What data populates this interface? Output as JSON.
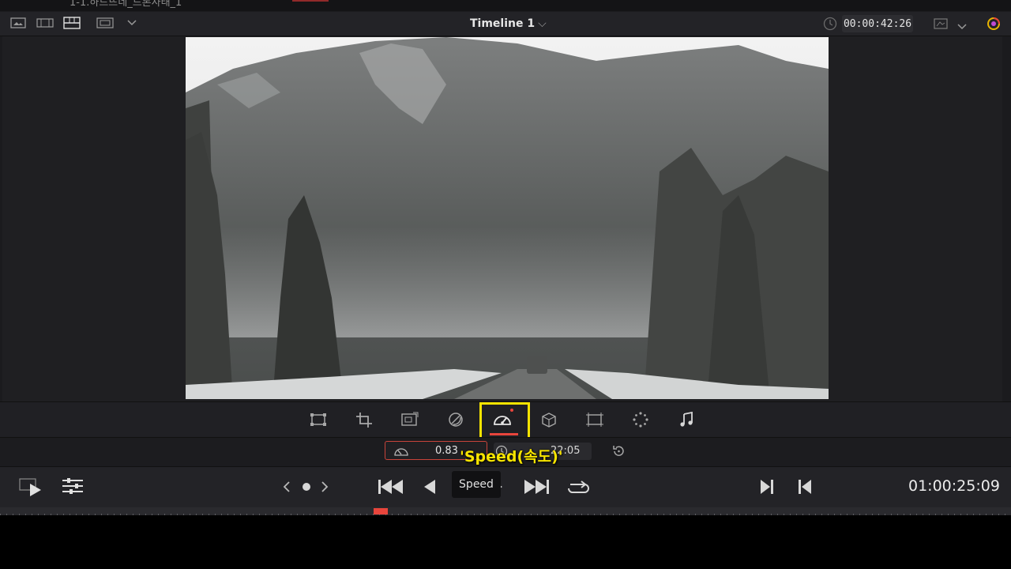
{
  "window": {
    "title": "1-1.하드뜨네_드론사태_1"
  },
  "viewer": {
    "timeline_name": "Timeline 1",
    "timeline_chevron": "⌵",
    "source_timecode": "00:00:42:26",
    "record_timecode": "01:00:25:09"
  },
  "toolbar": {
    "tools": [
      {
        "name": "transform-tool",
        "icon": "transform-icon"
      },
      {
        "name": "crop-tool",
        "icon": "crop-icon"
      },
      {
        "name": "dynamic-zoom-tool",
        "icon": "dynamic-zoom-icon"
      },
      {
        "name": "open-fx-tool",
        "icon": "open-fx-icon"
      },
      {
        "name": "speed-tool",
        "icon": "speedometer-icon"
      },
      {
        "name": "3d-tool",
        "icon": "cube-icon"
      },
      {
        "name": "smart-reframe-tool",
        "icon": "reframe-icon"
      },
      {
        "name": "fusion-tool",
        "icon": "dots-icon"
      },
      {
        "name": "audio-tool",
        "icon": "music-note-icon"
      }
    ]
  },
  "speed_params": {
    "speed_value": "0.83",
    "duration_value": "22:05"
  },
  "annotation": {
    "text": "'Speed(속도)'",
    "color": "#f7e400"
  },
  "tooltip": {
    "text": "Speed"
  },
  "colors": {
    "accent_red": "#e8453c",
    "highlight_yellow": "#f7e400",
    "panel": "#1b1b1e"
  }
}
